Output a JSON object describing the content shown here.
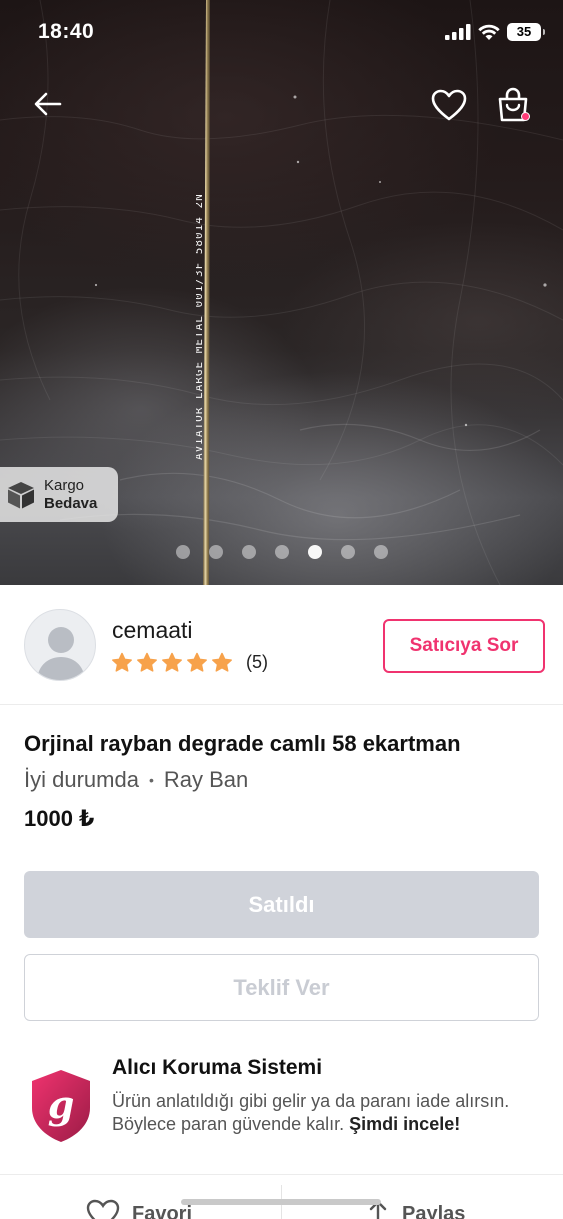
{
  "status_bar": {
    "time": "18:40",
    "battery": "35"
  },
  "hero": {
    "temple_text": "AVIATOR LARGE METAL 001/3F 58014 2N",
    "cargo_badge": {
      "line1": "Kargo",
      "line2": "Bedava",
      "icon": "box-icon"
    },
    "dots": {
      "count": 7,
      "active_index": 4
    }
  },
  "seller": {
    "name": "cemaati",
    "rating_stars": 5,
    "rating_count": "(5)",
    "ask_button": "Satıcıya Sor"
  },
  "product": {
    "title": "Orjinal rayban degrade camlı 58 ekartman",
    "condition": "İyi durumda",
    "separator": "•",
    "brand": "Ray Ban",
    "price": "1000 ₺"
  },
  "actions": {
    "sold_label": "Satıldı",
    "offer_label": "Teklif Ver"
  },
  "protection": {
    "title": "Alıcı Koruma Sistemi",
    "description": "Ürün anlatıldığı gibi gelir ya da paranı iade alırsın. Böylece paran güvende kalır.",
    "link": "Şimdi incele!"
  },
  "bottom_bar": {
    "favorite_label": "Favori",
    "share_label": "Paylaş"
  },
  "colors": {
    "accent": "#f0336f",
    "star": "#f7a24b",
    "disabled": "#d0d3da"
  }
}
